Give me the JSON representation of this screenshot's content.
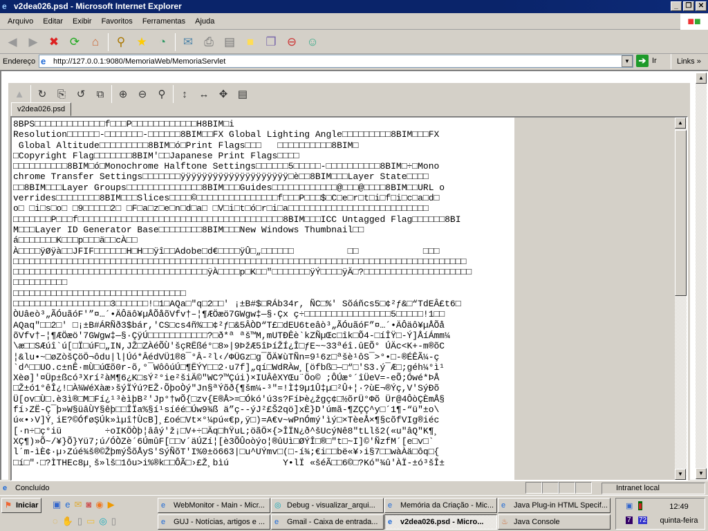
{
  "window": {
    "title": "v2dea026.psd - Microsoft Internet Explorer"
  },
  "menu": [
    "Arquivo",
    "Editar",
    "Exibir",
    "Favoritos",
    "Ferramentas",
    "Ajuda"
  ],
  "address": {
    "label": "Endereço",
    "url": "http://127.0.0.1:9080/MemoriaWeb/MemoriaServlet",
    "go_label": "Ir",
    "links_label": "Links"
  },
  "applet": {
    "tab_label": "v2dea026.psd",
    "lines": [
      "8BPS□□□□□□□□□□□□□f□□□P□□□□□□□□□□□□H8BIM□i",
      "Resolution□□□□□□-□□□□□□□-□□□□□□8BIM□□FX Global Lighting Angle□□□□□□□□□8BIM□□□FX",
      " Global Altitude□□□□□□□□□8BIM□ó□Print Flags□□□   □□□□□□□□□□8BIM□",
      "□Copyright Flag□□□□□□□8BIM'□□Japanese Print Flags□□□□",
      "□□□□□□□□□□8BIM□ó□Monochrome Halftone Settings□□□□□□5□□□□□-□□□□□□□□□□8BIM□÷□Mono",
      "chrome Transfer Settings□□□□□□□ÿÿÿÿÿÿÿÿÿÿÿÿÿÿÿÿÿÿÿÿ□è□□8BIM□□□Layer State□□□□",
      "□□8BIM□□□Layer Groups□□□□□□□□□□□□□□8BIM□□□Guides□□□□□□□□□□□□@□□□@□□□□8BIM□□URL o",
      "verrides□□□□□□□□8BIM□□□Slices□□□□©□□□□□□□□□□□□□□□f□□□P□□□$□C□e□r□t□i□f□i□c□a□d□",
      "o□ □i□s□o□ □9□□□□□2□ □F□a□z□e□n□d□a□ □V□i□t□ó□r□i□a□□□□□□□□□□□□□□□□□□□□□□□□□□",
      "□□□□□□□P□□□f□□□□□□□□□□□□□□□□□□□□□□□□□□□□□□□□□□□□□□8BIM□□□ICC Untagged Flag□□□□□□8BI",
      "M□□□Layer ID Generator Base□□□□□□□□8BIM□□□New Windows Thumbnail□□",
      "á□□□□□□□K□□□p□□□ä□□cÀ□□",
      "À□□□□ÿØÿà□□JFIF□□□□□□H□H□□ÿî□□Adobe□d€□□□□ÿÛ□„□□□□□□          □□            □□□",
      "□□□□□□□□□□□□□□□□□□□□□□□□□□□□□□□□□□□□□□□□□□□□□□□□□□□□□□□□□□□□□□□□□□□□□□□□□□□□□□□□□□□□",
      "□□□□□□□□□□□□□□□□□□□□□□□□□□□□□□□□□□□□ÿÀ□□□□p□K□□\"□□□□□□□ÿÝ□□□□ÿÄ□?□□□□□□□□□□□□□□□□□□□□",
      "□□□□□□□□□□",
      "□□□□□□□□□□□□□□□□□□□□□□□□□□□□□□□□",
      "□□□□□□□□□□□□□□□□□□3□□□□□□!□1□AQa□\"q□2□□' ¡±B#$□RÁb34r, ÑC□%' Sõáñcs5□¢²ƒ&□“TdEÂ£t6□",
      "ÒUâeò³„ÃÓuãóF'”¤…´•ÄÔäô¥µÅÕåõVfv†–¦¶ÆÖæö7GWgw‡—§·Çx ç÷□□□□□□□□□□□□□□□□5□□□□□!1□□",
      "AQaq\"□□2□' □¡±B#ÁRÑð3$bár,'CS□cs4ñ%□□¢²ƒ□&5ÂÒD“T£□dEU6teâò³„ÃÓuãóF”¤…´•ÄÔäô¥µÅÕå",
      "õVfv†–¦¶ÆÖæö'7GWgw‡—§·ÇÿÚ□□□□□□□□□□□?□ð*ª ªš™M,mUTÐÊè`kZÑµŒc□îk□Õ4-□íÎŸ□-Ý]ÅíÁmm¼",
      "\\æ□□SÆúî`ú[□Ï□úF□„IN,JŽ□ZÀéÕÙ'šçRËßé°□8»|9ÞžÆ5îÞíŽÍ¿Î□ƒE~~33ªéî.ûEÕ° ÚÄc<K+-m®õC",
      "¦&lu•~□øZòšÇöÖ¬ôdu|l|Úó*ÂédVÜ1®8¯°Â-²l‹/ΦÜGz□g¯ÕÄ¥ùTÑn=9¹6z□ªšè¹ôS¯>°•□-®ÉÊÃ¼-ç",
      "`d^□□UO.c±nÊ·mÙ□úŒõ0r-õ,°¯WôôúÚ□¶ËÝY□□2·u7f]„qí□WdRÀw¸[öfbß□—□“□'S3.ý¯Æ□;géh¼°ì¹",
      "Xèø]'¤Üp±ßcó³Xrí²àM¶6¿K□sÝ²°ie²šiÄ©\"WC?™Çúi)×IUÂêXYŒu¨Öo© ;ÔÚæ°´îÜeV=-eÕ;Ówé*ÞÅ",
      "□Ž±ó1°êÎ¿!□À¾WéXàæ›šýÏÝú?EŽ·ÕþoÒý\"Jn§ªÝõð{¶šm¼-³\"=!Ì‡9µ1Û‡µ□²Û+¦·?ùE¬®Ýç,V'SýÐõ",
      "Ü[ov□Ù□.è3ì®□M□Fí¿¹³èìþB²'Jp°†wÕ{□zv{E®Å>=□Ókó'ú3s?FíÞè¿žgç¢□½õrÜ°Φõ Ür@4ÔòÇÈmÅ§",
      "fí›ZË-Ç¯þ»W§üâÙY§êþ□□ÎÏa%§í¹síéé□Úw9¾ß ä”ç--ýJ²£Š2qö]xÈ}D'úmã-¶ZÇÇ^y□´1¶-“ü\"±o\\",
      "ú«•›V]Ý¸iE?©ÓføŞÚk»ìµî†ÙcB]¸£oé□Vt×°¼pú«€p,ÿ□)=A€v~wPnÓmý'ìý□×TèeÅ×¶§cõfVIg®iéc",
      "[·n÷□ç°iü        ÷oIKÖÒþ¦ââý'ž¡□V+÷□Äq□hŸuL;öãÖ×{>ÎÏN¿ð^šUcýNê8\"tLlš2(«u\"âQ\"K¶¸",
      "XÇ¶)»Õ~/¥}Õ}Yü7;ú/ÓÒZè´6ÚmûF[□□v´äÚZí¦[è3ÕÛoòýo¦®ûUì□ØÝÎ□®□\"t□~I]©'ÑzfM´[e□v□`",
      "l´m-ìÈ¢·µ›Zúé¾š®©ŽþmýŠõÅyS'SýÑõT'I%0±ö663|□u^UÝmv□(□-í¾;€i□□bë«¥›i§7□□wàÀä□ôq□{",
      "□í□\"·□?ÌTHEc8µ¸š»lš□1ôu>i%®k□□ÔÃ□›£Ž¸bìú          Y•lÏ «šéÃ□□6©□?Kó\"¾û'ÀÏ-±ó³šÎ±"
    ]
  },
  "status": {
    "text": "Concluído",
    "zone": "Intranet local"
  },
  "taskbar": {
    "start_label": "Iniciar",
    "tasks": [
      "WebMonitor - Main - Micr...",
      "Debug - visualizar_arqui...",
      "Memória da Criação - Mic...",
      "Java Plug-in HTML Specif...",
      "GUJ - Notícias, artigos e ...",
      "Gmail - Caixa de entrada...",
      "v2dea026.psd - Micro...",
      "Java Console"
    ],
    "clock": "12:49",
    "day": "quinta-feira"
  }
}
